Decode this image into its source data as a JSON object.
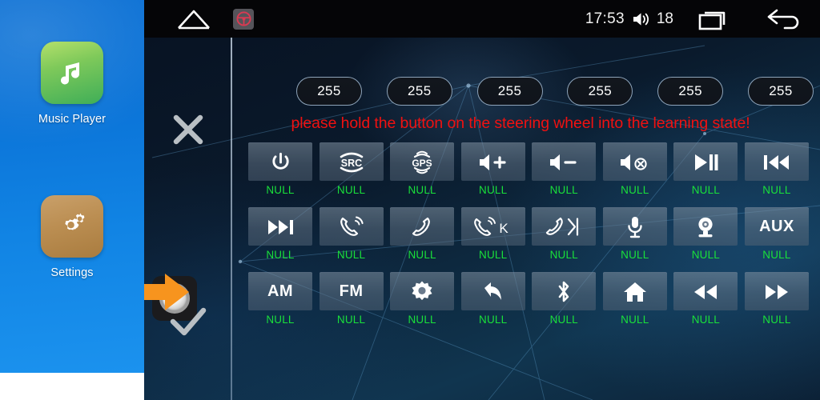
{
  "statusbar": {
    "home_icon": "home-outline-icon",
    "app_badge_icon": "steering-wheel-icon",
    "time": "17:53",
    "volume_icon": "volume-icon",
    "volume_value": "18",
    "recents_icon": "recents-icon",
    "back_icon": "back-arrow-icon"
  },
  "sidebar": {
    "items": [
      {
        "label": "Music Player",
        "icon": "music-note-icon"
      },
      {
        "label": "Settings",
        "icon": "gears-icon"
      }
    ]
  },
  "controls": {
    "cancel_icon": "close-x-icon",
    "confirm_icon": "check-icon",
    "knob_icon": "rotary-knob-icon",
    "pointer_icon": "orange-arrow-icon"
  },
  "values": {
    "pills": [
      "255",
      "255",
      "255",
      "255",
      "255",
      "255"
    ]
  },
  "warning": {
    "text": "please hold the button on the steering wheel into the learning state!",
    "color": "#ef1111"
  },
  "colors": {
    "label_green": "#19e03a",
    "sidebar_blue": "#0b74d8",
    "pointer_orange": "#f7941e"
  },
  "keypad": {
    "rows": [
      [
        {
          "icon": "power-icon",
          "text": "",
          "label": "NULL"
        },
        {
          "icon": "src-icon",
          "text": "SRC",
          "label": "NULL"
        },
        {
          "icon": "gps-icon",
          "text": "GPS",
          "label": "NULL"
        },
        {
          "icon": "volume-up-icon",
          "text": "",
          "label": "NULL"
        },
        {
          "icon": "volume-down-icon",
          "text": "",
          "label": "NULL"
        },
        {
          "icon": "volume-mute-icon",
          "text": "",
          "label": "NULL"
        },
        {
          "icon": "play-pause-icon",
          "text": "",
          "label": "NULL"
        },
        {
          "icon": "previous-track-icon",
          "text": "",
          "label": "NULL"
        }
      ],
      [
        {
          "icon": "next-track-icon",
          "text": "",
          "label": "NULL"
        },
        {
          "icon": "call-answer-icon",
          "text": "",
          "label": "NULL"
        },
        {
          "icon": "call-end-icon",
          "text": "",
          "label": "NULL"
        },
        {
          "icon": "call-answer-k-icon",
          "text": "K",
          "label": "NULL"
        },
        {
          "icon": "call-end-arrow-icon",
          "text": "",
          "label": "NULL"
        },
        {
          "icon": "microphone-icon",
          "text": "",
          "label": "NULL"
        },
        {
          "icon": "camera-icon",
          "text": "",
          "label": "NULL"
        },
        {
          "icon": "aux-icon",
          "text": "AUX",
          "label": "NULL"
        }
      ],
      [
        {
          "icon": "am-icon",
          "text": "AM",
          "label": "NULL"
        },
        {
          "icon": "fm-icon",
          "text": "FM",
          "label": "NULL"
        },
        {
          "icon": "gear-icon",
          "text": "",
          "label": "NULL"
        },
        {
          "icon": "back-curve-icon",
          "text": "",
          "label": "NULL"
        },
        {
          "icon": "bluetooth-icon",
          "text": "",
          "label": "NULL"
        },
        {
          "icon": "home-icon",
          "text": "",
          "label": "NULL"
        },
        {
          "icon": "rewind-icon",
          "text": "",
          "label": "NULL"
        },
        {
          "icon": "fast-forward-icon",
          "text": "",
          "label": "NULL"
        }
      ]
    ]
  }
}
